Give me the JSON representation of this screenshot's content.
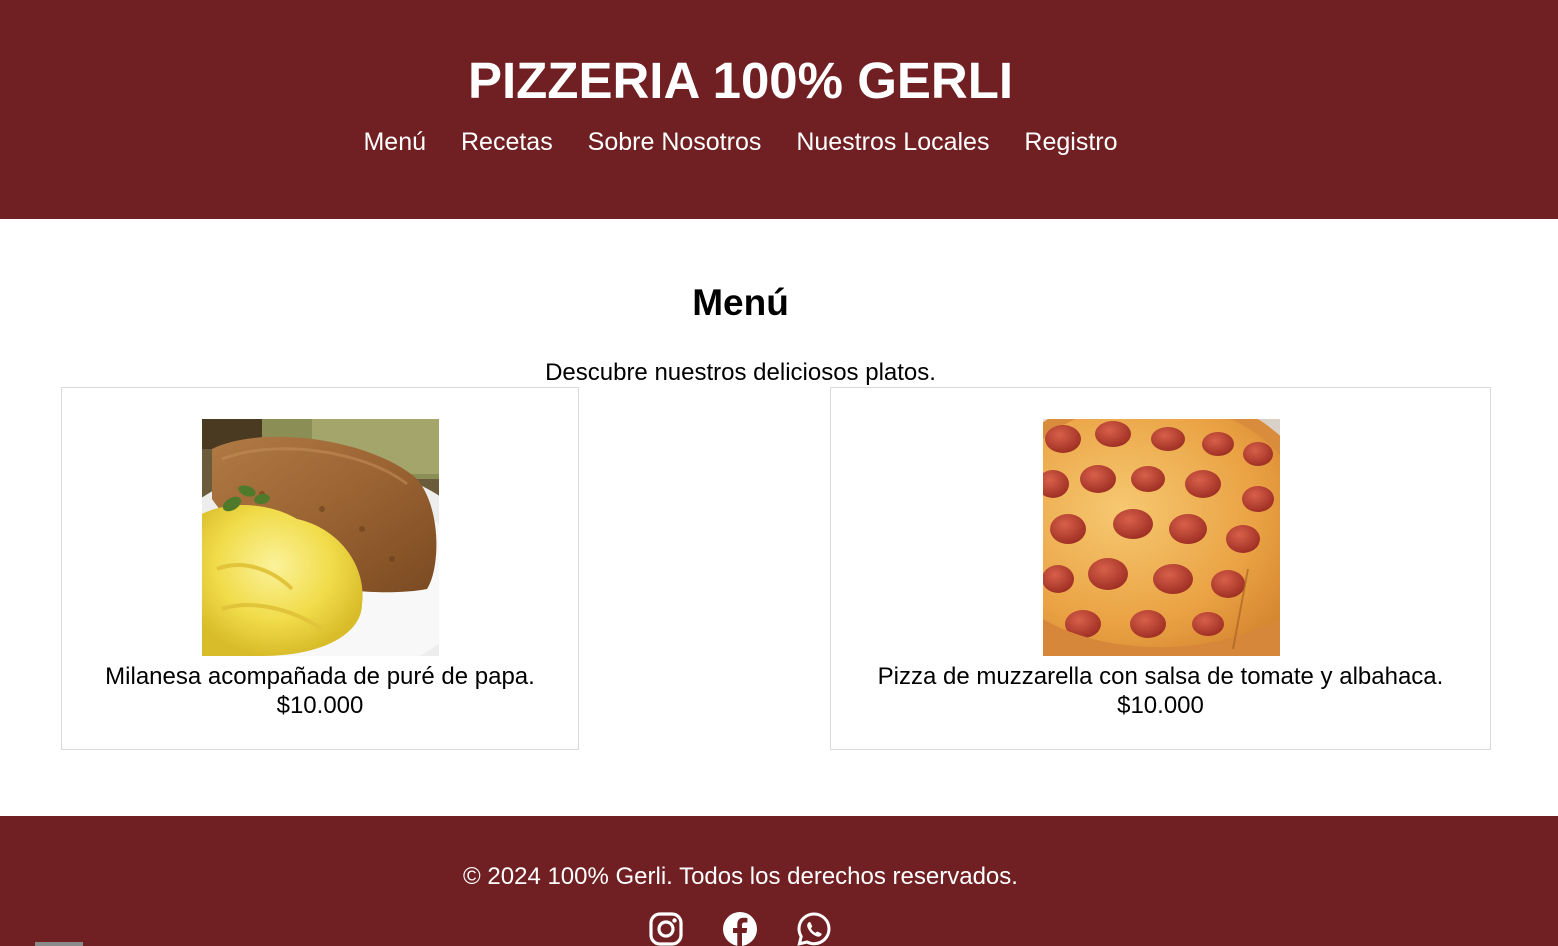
{
  "header": {
    "title": "PIZZERIA 100% GERLI",
    "nav": [
      "Menú",
      "Recetas",
      "Sobre Nosotros",
      "Nuestros Locales",
      "Registro"
    ]
  },
  "main": {
    "heading": "Menú",
    "intro": "Descubre nuestros deliciosos platos.",
    "dishes": [
      {
        "description": "Milanesa acompañada de puré de papa.",
        "price": "$10.000",
        "image_icon": "milanesa-photo"
      },
      {
        "description": "Pizza de muzzarella con salsa de tomate y albahaca.",
        "price": "$10.000",
        "image_icon": "pizza-photo"
      }
    ]
  },
  "footer": {
    "copyright": "© 2024 100% Gerli. Todos los derechos reservados.",
    "social": [
      "instagram-icon",
      "facebook-icon",
      "whatsapp-icon"
    ]
  },
  "colors": {
    "brand": "#701f22",
    "header_text": "#ffffff",
    "card_border": "#d9d9d9"
  }
}
